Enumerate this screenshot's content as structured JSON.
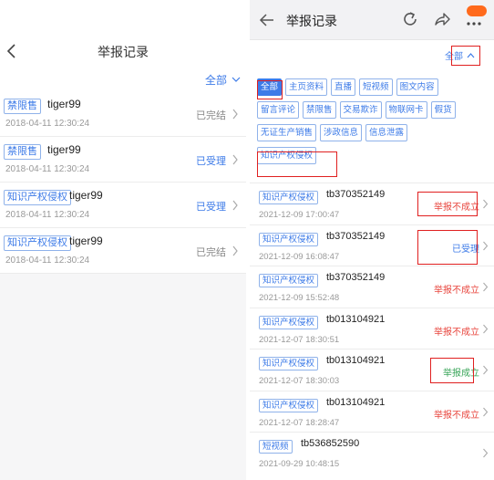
{
  "left": {
    "title": "举报记录",
    "filter_label": "全部",
    "items": [
      {
        "tag": "禁限售",
        "name": "tiger99",
        "time": "2018-04-11 12:30:24",
        "status": "已完结"
      },
      {
        "tag": "禁限售",
        "name": "tiger99",
        "time": "2018-04-11 12:30:24",
        "status": "已受理"
      },
      {
        "tag": "知识产权侵权",
        "name": "tiger99",
        "time": "2018-04-11 12:30:24",
        "status": "已受理"
      },
      {
        "tag": "知识产权侵权",
        "name": "tiger99",
        "time": "2018-04-11 12:30:24",
        "status": "已完结"
      }
    ]
  },
  "right": {
    "title": "举报记录",
    "filter_label": "全部",
    "chips": [
      [
        "全部",
        "主页资料",
        "直播",
        "短视频",
        "图文内容"
      ],
      [
        "留言评论",
        "禁限售",
        "交易欺诈",
        "物联网卡",
        "假货"
      ],
      [
        "无证生产销售",
        "涉政信息",
        "信息泄露"
      ],
      [
        "知识产权侵权"
      ]
    ],
    "items": [
      {
        "tag": "知识产权侵权",
        "id": "tb370352149",
        "time": "2021-12-09 17:00:47",
        "status": "举报不成立"
      },
      {
        "tag": "知识产权侵权",
        "id": "tb370352149",
        "time": "2021-12-09 16:08:47",
        "status": "已受理"
      },
      {
        "tag": "知识产权侵权",
        "id": "tb370352149",
        "time": "2021-12-09 15:52:48",
        "status": "举报不成立"
      },
      {
        "tag": "知识产权侵权",
        "id": "tb013104921",
        "time": "2021-12-07 18:30:51",
        "status": "举报不成立"
      },
      {
        "tag": "知识产权侵权",
        "id": "tb013104921",
        "time": "2021-12-07 18:30:03",
        "status": "举报成立"
      },
      {
        "tag": "知识产权侵权",
        "id": "tb013104921",
        "time": "2021-12-07 18:28:47",
        "status": "举报不成立"
      },
      {
        "tag": "短视频",
        "id": "tb536852590",
        "time": "2021-09-29 10:48:15",
        "status": ""
      }
    ]
  },
  "colors": {
    "accent": "#3d7be8",
    "red": "#e8463e",
    "green": "#3aa65a",
    "annotation": "#e02020",
    "badge": "#ff6a1c"
  }
}
